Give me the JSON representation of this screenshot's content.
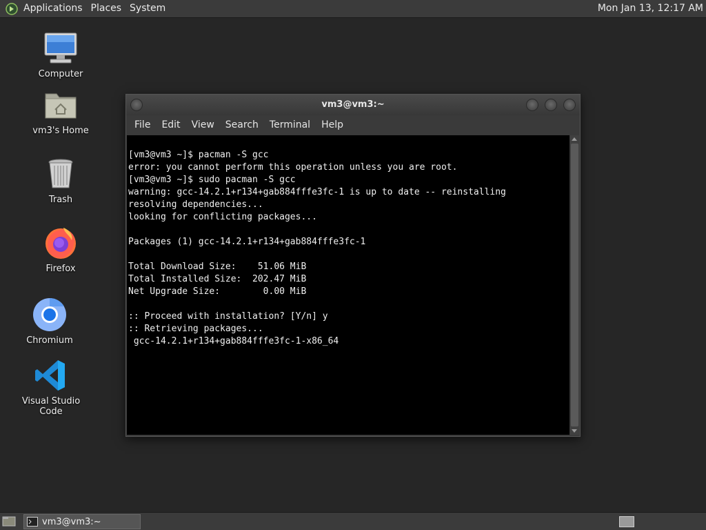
{
  "top_panel": {
    "menus": [
      "Applications",
      "Places",
      "System"
    ],
    "clock": "Mon Jan 13, 12:17 AM"
  },
  "desktop": {
    "icons": [
      {
        "label": "Computer",
        "icon": "computer-icon"
      },
      {
        "label": "vm3's Home",
        "icon": "home-folder-icon"
      },
      {
        "label": "Trash",
        "icon": "trash-icon"
      },
      {
        "label": "Firefox",
        "icon": "firefox-icon"
      },
      {
        "label": "Chromium",
        "icon": "chromium-icon"
      },
      {
        "label": "Visual Studio Code",
        "icon": "vscode-icon"
      }
    ]
  },
  "window": {
    "title": "vm3@vm3:~",
    "menu": [
      "File",
      "Edit",
      "View",
      "Search",
      "Terminal",
      "Help"
    ],
    "terminal_lines": [
      "[vm3@vm3 ~]$ pacman -S gcc",
      "error: you cannot perform this operation unless you are root.",
      "[vm3@vm3 ~]$ sudo pacman -S gcc",
      "warning: gcc-14.2.1+r134+gab884fffe3fc-1 is up to date -- reinstalling",
      "resolving dependencies...",
      "looking for conflicting packages...",
      "",
      "Packages (1) gcc-14.2.1+r134+gab884fffe3fc-1",
      "",
      "Total Download Size:    51.06 MiB",
      "Total Installed Size:  202.47 MiB",
      "Net Upgrade Size:        0.00 MiB",
      "",
      ":: Proceed with installation? [Y/n] y",
      ":: Retrieving packages...",
      " gcc-14.2.1+r134+gab884fffe3fc-1-x86_64"
    ]
  },
  "bottom_panel": {
    "task_label": "vm3@vm3:~"
  },
  "colors": {
    "desktop_bg": "#262626",
    "panel_bg": "#3b3b3b",
    "terminal_bg": "#000000",
    "terminal_fg": "#f0f0f0"
  }
}
